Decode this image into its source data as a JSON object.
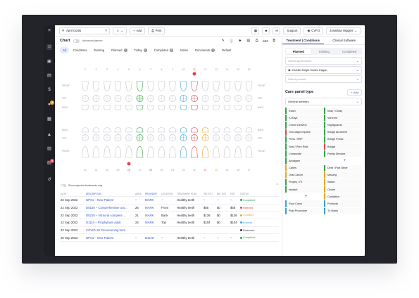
{
  "search": {
    "value": "April Curtis"
  },
  "topbar": {
    "add_label": "Add",
    "print_label": "Print",
    "support_label": "Support",
    "location_label": "CVFO",
    "user_label": "Jonathan Higgins"
  },
  "chartbar": {
    "title": "Chart",
    "advanced_label": "Advanced planner",
    "cdt_label": "CDT"
  },
  "chart_tabs": [
    {
      "label": "All",
      "count": null
    },
    {
      "label": "Conditions",
      "count": null
    },
    {
      "label": "Existing",
      "count": null
    },
    {
      "label": "Planned",
      "count": "2"
    },
    {
      "label": "Today",
      "count": "0"
    },
    {
      "label": "Completed",
      "count": "5"
    },
    {
      "label": "Notes",
      "count": null
    },
    {
      "label": "Documents",
      "count": "0"
    },
    {
      "label": "Default",
      "count": null
    }
  ],
  "tooth_numbers_upper": [
    "1",
    "2",
    "3",
    "4",
    "5",
    "6",
    "7",
    "8",
    "9",
    "10",
    "11",
    "12",
    "13",
    "14",
    "15",
    "16"
  ],
  "tooth_numbers_lower": [
    "32",
    "31",
    "30",
    "29",
    "28",
    "27",
    "26",
    "25",
    "24",
    "23",
    "22",
    "21",
    "20",
    "19",
    "18",
    "17"
  ],
  "tooth_number_colors": {
    "7": "#e6424f",
    "11": "#e6424f",
    "26": "#33a34a",
    "28": "#e6424f",
    "21": "#e6424f",
    "20": "#f0a320"
  },
  "row_labels_upper": {
    "left": [
      "FRONT",
      "TOP",
      "BACK"
    ],
    "right": [
      "FRONT",
      "TOP",
      "BACK"
    ]
  },
  "row_labels_lower": {
    "left": [
      "BACK",
      "TOP",
      "FRONT"
    ],
    "right": [
      "BACK",
      "TOP",
      "FRONT"
    ]
  },
  "rejected_label": "Show rejected treatments only",
  "table": {
    "headers": [
      "Date",
      "Description",
      "Area",
      "Provider",
      "Location",
      "Treatment plan",
      "Pat. est",
      "Ins. est",
      "Fee",
      "Status"
    ],
    "rows": [
      {
        "date": "22 Sep 2022",
        "desc": "NPS1 – New Patient",
        "area": "–",
        "provider": "MARK",
        "location": "–",
        "plan": "Healthy teeth",
        "pat": "–",
        "ins": "–",
        "fee": "–",
        "status": "Completed",
        "status_color": "#33a34a"
      },
      {
        "date": "22 Sep 2022",
        "desc": "D0150 – Comprehensive ora...",
        "area": "26",
        "provider": "MARK",
        "location": "Front",
        "plan": "Healthy teeth",
        "pat": "$65",
        "ins": "$0",
        "fee": "$65",
        "status": "Rejected",
        "status_color": "#e6424f"
      },
      {
        "date": "22 Sep 2022",
        "desc": "D0210 – Intraoral complete ...",
        "area": "21",
        "provider": "MARK",
        "location": "Back",
        "plan": "Healthy teeth",
        "pat": "$136",
        "ins": "$0",
        "fee": "$136",
        "status": "Condition",
        "status_color": "#f0a320"
      },
      {
        "date": "22 Sep 2022",
        "desc": "D1110 – Prophylaxis adult",
        "area": "24",
        "provider": "MARK",
        "location": "Top",
        "plan": "Healthy teeth",
        "pat": "$104",
        "ins": "$0",
        "fee": "$104",
        "status": "Planned",
        "status_color": "#3aa0e0"
      },
      {
        "date": "22 Sep 2022",
        "desc": "COVID-19 Prescreening form",
        "area": "",
        "provider": "",
        "location": "",
        "plan": "",
        "pat": "",
        "ins": "",
        "fee": "",
        "status": "Document",
        "status_color": "#333333"
      },
      {
        "date": "20 Sep 2022",
        "desc": "NPS1 – New Patient",
        "area": "–",
        "provider": "D3LN7",
        "location": "–",
        "plan": "Healthy teeth",
        "pat": "–",
        "ins": "–",
        "fee": "–",
        "status": "Completed",
        "status_color": "#33a34a"
      }
    ]
  },
  "right": {
    "tabs": [
      "Treatment | Conditions",
      "Clinical Software"
    ],
    "sub_tabs": [
      "Planned",
      "Existing",
      "Completed"
    ],
    "appointment_placeholder": "Select appointment",
    "location_value": "EAGAN Bright Smiles Eagan",
    "provider_placeholder": "Select provider",
    "care_panel_title": "Care panel type",
    "add_label": "Add",
    "panel_type": "General dentistry",
    "items": [
      {
        "l": "Exam",
        "c": "#33a34a"
      },
      {
        "l": "Inlay / Onlay",
        "c": "#33a34a"
      },
      {
        "l": "X-Rays",
        "c": "#33a34a"
      },
      {
        "l": "Veneers",
        "c": "#33a34a"
      },
      {
        "l": "Crown Delivery",
        "c": "#33a34a"
      },
      {
        "l": "Nightguards",
        "c": "#33a34a"
      },
      {
        "l": "Two stage implant",
        "c": "#e6424f"
      },
      {
        "l": "Bridge Abutment",
        "c": "#33a34a"
      },
      {
        "l": "Perio / SRP",
        "c": "#33a34a"
      },
      {
        "l": "Bridge Pontic",
        "c": "#33a34a"
      },
      {
        "l": "Seal / Prev Rest",
        "c": "#33a34a"
      },
      {
        "l": "Bridge",
        "c": "#e6424f"
      },
      {
        "l": "Composite",
        "c": "#33a34a"
      },
      {
        "l": "Partial Denture",
        "c": "#33a34a"
      },
      {
        "l": "Amalgam",
        "c": "#33a34a"
      },
      {
        "l": "+",
        "c": "plus"
      },
      {
        "l": "Caries",
        "c": "#f0a320"
      },
      {
        "l": "Dent / Part Other",
        "c": "#33a34a"
      },
      {
        "l": "Oral Cancer",
        "c": "#f0a320"
      },
      {
        "l": "Missing",
        "c": "#f0a320"
      },
      {
        "l": "Prophy / F1",
        "c": "#33a34a"
      },
      {
        "l": "Watch",
        "c": "#f0a320"
      },
      {
        "l": "Implant",
        "c": "#33a34a"
      },
      {
        "l": "Ozone",
        "c": "#f0a320"
      },
      {
        "l": "+",
        "c": "plus"
      },
      {
        "l": "Cavitation",
        "c": "#f0a320"
      },
      {
        "l": "Root Canal",
        "c": "#3aa0e0"
      },
      {
        "l": "Products",
        "c": "#3aa0e0"
      },
      {
        "l": "Pulp Procedure",
        "c": "#3aa0e0"
      },
      {
        "l": "Tx Notes",
        "c": "#3aa0e0"
      }
    ]
  },
  "rail_icons": [
    "menu-icon",
    "patient-icon",
    "id-card-icon",
    "clipboard-icon",
    "dollar-icon",
    "pill-icon",
    "calendar-icon",
    "warning-icon",
    "document-icon",
    "chat-icon",
    "history-icon"
  ],
  "rail_badges": {
    "pill-icon": "3",
    "chat-icon": "5"
  }
}
